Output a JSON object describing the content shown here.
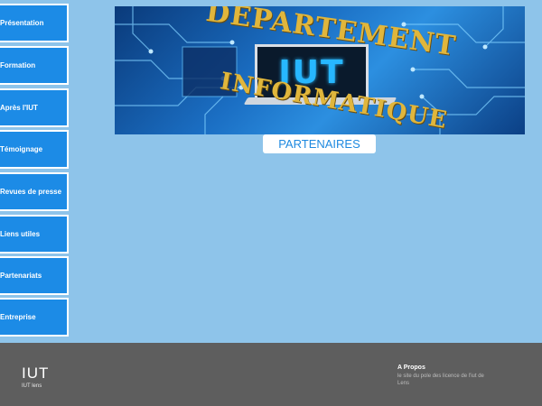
{
  "sidebar": {
    "items": [
      {
        "label": "Présentation"
      },
      {
        "label": "Formation"
      },
      {
        "label": "Après l'IUT"
      },
      {
        "label": "Témoignage"
      },
      {
        "label": "Revues de presse"
      },
      {
        "label": "Liens utiles"
      },
      {
        "label": "Partenariats"
      },
      {
        "label": "Entreprise"
      }
    ]
  },
  "banner": {
    "top_text": "DEPARTEMENT",
    "laptop_text": "IUT",
    "bottom_text": "INFORMATIQUE"
  },
  "main": {
    "title": "PARTENAIRES"
  },
  "footer": {
    "logo_text": "IUT",
    "logo_subtext": "IUT lens",
    "about_title": "A Propos",
    "about_text": "le site du pole des licence de l'iut de Lens"
  },
  "colors": {
    "background": "#8ec4ea",
    "nav_button": "#1c8be6",
    "footer": "#5e5e5e",
    "banner_gold": "#e0b63c"
  }
}
